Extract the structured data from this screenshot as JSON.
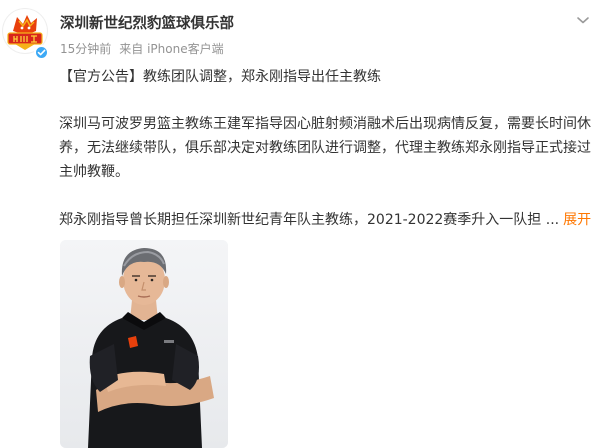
{
  "post": {
    "author": "深圳新世纪烈豹篮球俱乐部",
    "time": "15分钟前",
    "source": "来自 iPhone客户端",
    "headline": "【官方公告】教练团队调整，郑永刚指导出任主教练",
    "body_lines": [
      "深圳马可波罗男篮主教练王建军指导因心脏射频消融术后出现病情反复，需要长时间休",
      "养，无法继续带队，俱乐部决定对教练团队进行调整，代理主教练郑永刚指导正式接过",
      "主帅教鞭。"
    ],
    "teaser": "郑永刚指导曾长期担任深圳新世纪青年队主教练，2021-2022赛季升入一队担",
    "ellipsis": "...",
    "expand_label": "展开"
  },
  "icons": {
    "avatar": "team-logo",
    "verified": "verified-badge-icon",
    "more": "chevron-down-icon"
  },
  "colors": {
    "text": "#333333",
    "meta": "#939393",
    "expand": "#ff7700",
    "verified": "#3da9f5"
  }
}
